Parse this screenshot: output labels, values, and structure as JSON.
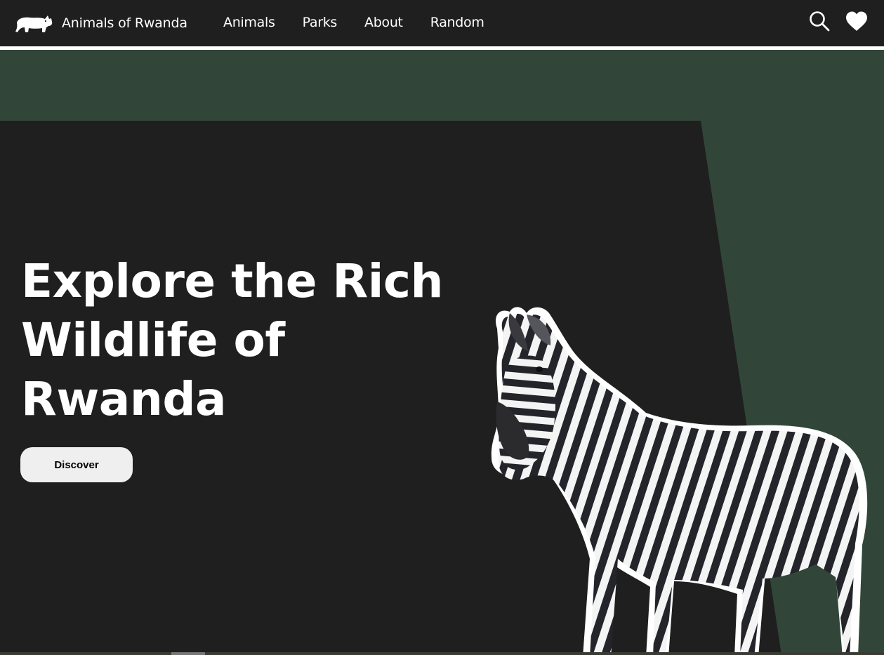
{
  "brand": {
    "name": "Animals of Rwanda",
    "logo_icon": "rhino-icon"
  },
  "nav": {
    "links": [
      {
        "label": "Animals"
      },
      {
        "label": "Parks"
      },
      {
        "label": "About"
      },
      {
        "label": "Random"
      }
    ],
    "icons": [
      "search-icon",
      "heart-icon"
    ]
  },
  "hero": {
    "title": "Explore the Rich Wildlife of Rwanda",
    "cta_label": "Discover",
    "image": "zebra-image"
  },
  "colors": {
    "navbar_bg": "#1f1f1f",
    "hero_panel": "#1f1f1f",
    "hero_accent": "#314639",
    "button_bg": "#efefef",
    "text": "#ffffff"
  }
}
